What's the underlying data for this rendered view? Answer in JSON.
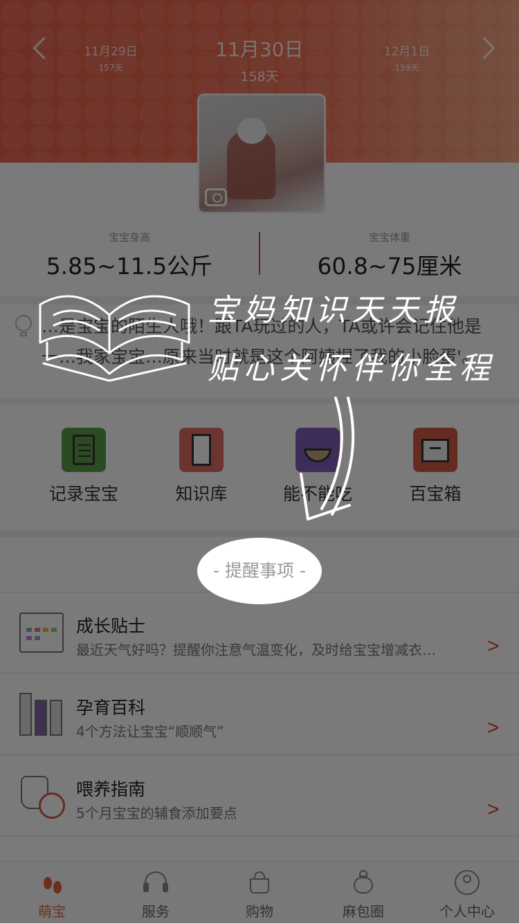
{
  "header": {
    "prev": {
      "date": "11月29日",
      "days": "157天"
    },
    "current": {
      "date": "11月30日",
      "days": "158天"
    },
    "next": {
      "date": "12月1日",
      "days": "159天"
    }
  },
  "stats": {
    "left": {
      "label": "宝宝身高",
      "value": "5.85~11.5公斤"
    },
    "right": {
      "label": "宝宝体重",
      "value": "60.8~75厘米"
    }
  },
  "tip": {
    "text": "…是宝宝的陌生人哦！跟TA玩过的人，TA或许会记住他是一…我家宝宝…原来当时就是这个阿姨捏了我的小脸蛋'。"
  },
  "tools": [
    {
      "label": "记录宝宝",
      "icon": "clipboard-icon",
      "color": "#5aa04a"
    },
    {
      "label": "知识库",
      "icon": "document-icon",
      "color": "#e06d68"
    },
    {
      "label": "能不能吃",
      "icon": "bowl-icon",
      "color": "#7f5fb8"
    },
    {
      "label": "百宝箱",
      "icon": "box-icon",
      "color": "#d55a44"
    }
  ],
  "reminder": {
    "title": "- 提醒事项 -"
  },
  "rows": [
    {
      "title": "成长贴士",
      "subtitle": "最近天气好吗？提醒你注意气温变化，及时给宝宝增减衣…",
      "icon": "calendar-icon",
      "chevron": ">"
    },
    {
      "title": "孕育百科",
      "subtitle": "4个方法让宝宝“顺顺气”",
      "icon": "binders-icon",
      "chevron": ">"
    },
    {
      "title": "喂养指南",
      "subtitle": "5个月宝宝的辅食添加要点",
      "icon": "jug-orange-icon",
      "chevron": ">"
    }
  ],
  "tabs": [
    {
      "label": "萌宝",
      "icon": "footprints-icon",
      "active": true
    },
    {
      "label": "服务",
      "icon": "headset-icon",
      "active": false
    },
    {
      "label": "购物",
      "icon": "basket-icon",
      "active": false
    },
    {
      "label": "麻包圈",
      "icon": "bag-icon",
      "active": false
    },
    {
      "label": "个人中心",
      "icon": "user-icon",
      "active": false
    }
  ],
  "banner": {
    "line1": "宝妈知识天天报",
    "line2": "贴心关怀伴你全程"
  },
  "colors": {
    "accent": "#d9463a",
    "header": "#ef6d52",
    "active_tab": "#e8603c"
  }
}
